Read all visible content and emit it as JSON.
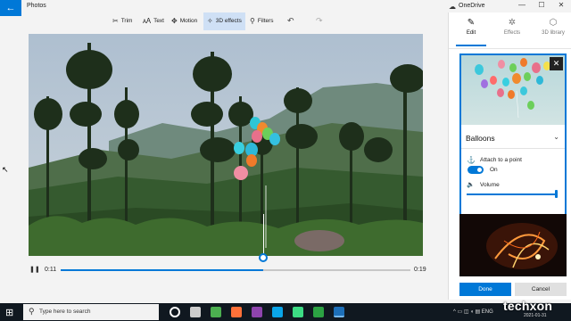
{
  "app": {
    "title": "Photos",
    "back_glyph": "←"
  },
  "onedrive": {
    "label": "OneDrive",
    "icon": "cloud-icon"
  },
  "window_controls": [
    "—",
    "☐",
    "✕"
  ],
  "toolbar": {
    "items": [
      {
        "label": "Trim",
        "icon": "trim-icon",
        "glyph": "✂",
        "active": false
      },
      {
        "label": "Text",
        "icon": "text-icon",
        "glyph": "🗚",
        "active": false
      },
      {
        "label": "Motion",
        "icon": "motion-icon",
        "glyph": "✥",
        "active": false
      },
      {
        "label": "3D effects",
        "icon": "sparkle-icon",
        "glyph": "✧",
        "active": true
      },
      {
        "label": "Filters",
        "icon": "filter-icon",
        "glyph": "⚲",
        "active": false
      }
    ],
    "undo_glyph": "↶",
    "redo_glyph": "↷"
  },
  "player": {
    "play_glyph": "❚❚",
    "current_time": "0:11",
    "duration": "0:19",
    "progress": 0.58
  },
  "panel": {
    "tabs": [
      {
        "label": "Edit",
        "glyph": "✎",
        "active": true
      },
      {
        "label": "Effects",
        "glyph": "✲",
        "active": false
      },
      {
        "label": "3D library",
        "glyph": "⬡",
        "active": false
      }
    ],
    "effect": {
      "title": "Balloons",
      "close_glyph": "✕",
      "chevron": "⌄",
      "attach_label": "Attach to a point",
      "attach_glyph": "⚓",
      "toggle_label": "On",
      "toggle_on": true,
      "volume_label": "Volume",
      "volume_glyph": "🔈",
      "volume_level": 1.0
    },
    "done_label": "Done",
    "cancel_label": "Cancel"
  },
  "taskbar": {
    "start_glyph": "⊞",
    "search_placeholder": "Type here to search",
    "search_glyph": "⚲",
    "apps": [
      {
        "name": "cortana-icon",
        "color": "#ffffff"
      },
      {
        "name": "task-view-icon",
        "color": "#cccccc"
      },
      {
        "name": "chrome-icon",
        "color": "#4caf50"
      },
      {
        "name": "firefox-icon",
        "color": "#ff7139"
      },
      {
        "name": "visual-studio-icon",
        "color": "#8e44ad"
      },
      {
        "name": "azure-data-studio-icon",
        "color": "#0aa5e8"
      },
      {
        "name": "android-studio-icon",
        "color": "#3ddc84"
      },
      {
        "name": "xbox-icon",
        "color": "#2ca243"
      },
      {
        "name": "photos-icon",
        "color": "#1d6fb8"
      }
    ],
    "tray_glyphs": "^ ▭ ◫ ◖ ▤ ENG"
  },
  "watermark": {
    "brand": "techxon",
    "date": "2021-01-31"
  }
}
